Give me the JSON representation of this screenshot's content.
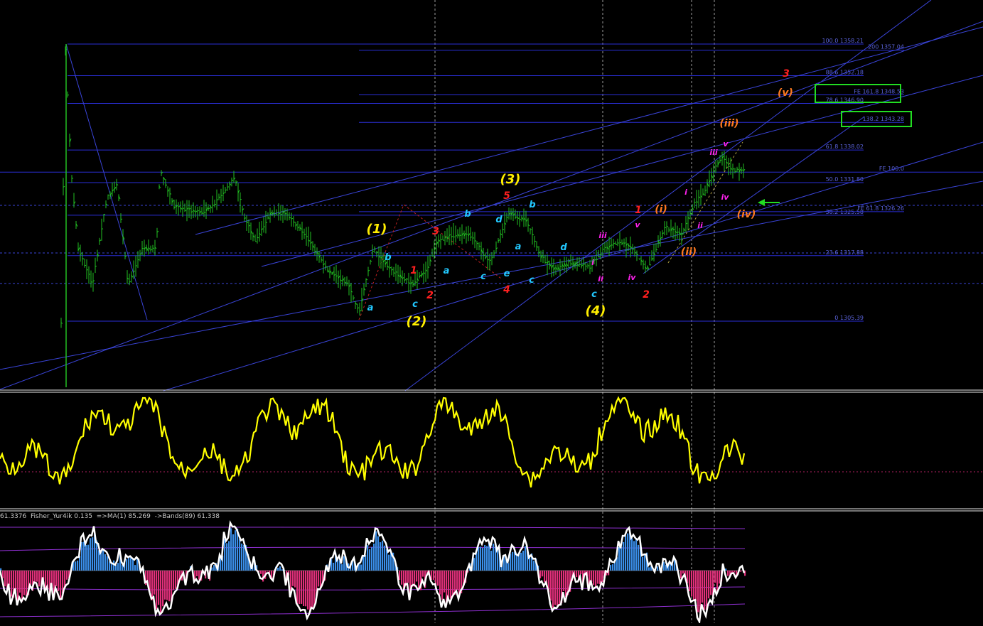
{
  "colors": {
    "background": "#000000",
    "price_bars": "#22c022",
    "level_lines": "#2a2ed6",
    "trend_lines": "#3a44d8",
    "level_text": "#5a62d8",
    "oscillator": "#ffff00",
    "fisher_line": "#ffffff",
    "hist_positive": "#3a8ee8",
    "hist_negative": "#e0307a",
    "bands": "#8e2fd0",
    "highlight_box": "#22dd22",
    "arrow": "#22dd22",
    "wave_yellow": "#ffee00",
    "wave_red": "#ff2020",
    "wave_cyan": "#22c8ff",
    "wave_magenta": "#ff22ee",
    "wave_orange": "#ff7a20"
  },
  "fib_levels": [
    {
      "label": "100.0 1358.21",
      "price": 1358.21
    },
    {
      "label": "200 1357.04",
      "price": 1357.04
    },
    {
      "label": "88.6 1352.18",
      "price": 1352.18
    },
    {
      "label": "FE 161.8 1348.53",
      "price": 1348.53
    },
    {
      "label": "78.6 1346.90",
      "price": 1346.9
    },
    {
      "label": "138.2 1343.28",
      "price": 1343.28
    },
    {
      "label": "61.8 1338.02",
      "price": 1338.02
    },
    {
      "label": "FE 100.0",
      "price": 1333.8
    },
    {
      "label": "50.0 1331.80",
      "price": 1331.8
    },
    {
      "label": "38.2 1325.58",
      "price": 1325.58
    },
    {
      "label": "FE 61.8 1326.26",
      "price": 1326.26
    },
    {
      "label": "23.6 1317.88",
      "price": 1317.88
    },
    {
      "label": "0 1305.39",
      "price": 1305.39
    }
  ],
  "wave_labels": {
    "yellow": [
      "(1)",
      "(2)",
      "(3)",
      "(4)"
    ],
    "red": [
      "1",
      "2",
      "3",
      "4",
      "5",
      "1",
      "2",
      "3"
    ],
    "cyan": [
      "a",
      "b",
      "c",
      "a",
      "b",
      "c",
      "d",
      "e",
      "a",
      "b",
      "c",
      "d",
      "c"
    ],
    "magenta": [
      "iii",
      "i",
      "ii",
      "iv",
      "i",
      "ii",
      "iii",
      "iv",
      "v",
      "v"
    ],
    "orange": [
      "(i)",
      "(ii)",
      "(iii)",
      "(iv)",
      "(v)"
    ]
  },
  "indicator_header": "61.3376  Fisher_Yur4ik 0.135  =>MA(1) 85.269  ->Bands(89) 61.338",
  "chart_data": {
    "type": "line",
    "ylim": [
      1290,
      1365
    ],
    "series": [],
    "note_levels_from": "fib_levels"
  }
}
